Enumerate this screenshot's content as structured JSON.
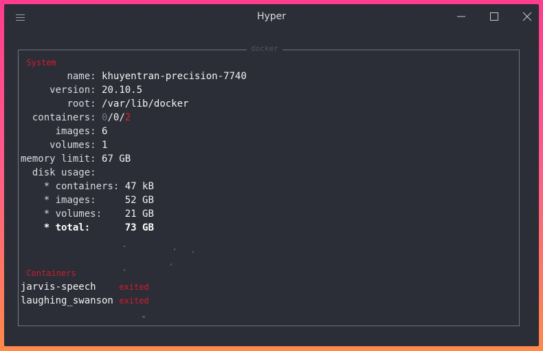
{
  "window": {
    "title": "Hyper"
  },
  "frame": {
    "title": "docker"
  },
  "system": {
    "heading": "System",
    "name_label": "name:",
    "name_value": "khuyentran-precision-7740",
    "version_label": "version:",
    "version_value": "20.10.5",
    "root_label": "root:",
    "root_value": "/var/lib/docker",
    "containers_label": "containers:",
    "containers_running": "0",
    "containers_paused": "0",
    "containers_stopped": "2",
    "images_label": "images:",
    "images_value": "6",
    "volumes_label": "volumes:",
    "volumes_value": "1",
    "memory_label": "memory limit:",
    "memory_value": "67 GB",
    "disk_label": "disk usage:",
    "disk": [
      {
        "label": "* containers:",
        "value": "47 kB"
      },
      {
        "label": "* images:",
        "value": "52 GB"
      },
      {
        "label": "* volumes:",
        "value": "21 GB"
      },
      {
        "label": "* total:",
        "value": "73 GB"
      }
    ]
  },
  "containers_section": {
    "heading": "Containers",
    "items": [
      {
        "name": "jarvis-speech",
        "status": "exited"
      },
      {
        "name": "laughing_swanson",
        "status": "exited"
      }
    ]
  },
  "colors": {
    "accent_red": "#e41d34",
    "background": "#2b2e36",
    "border": "#6e747c"
  },
  "icons": [
    "hamburger-menu-icon",
    "minimize-icon",
    "maximize-icon",
    "close-icon"
  ]
}
